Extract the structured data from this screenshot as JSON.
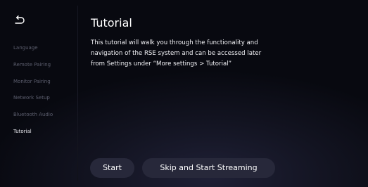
{
  "nav": {
    "back_icon": "back-arrow-icon"
  },
  "sidebar": {
    "items": [
      {
        "label": "Language",
        "active": false
      },
      {
        "label": "Remote Pairing",
        "active": false
      },
      {
        "label": "Monitor Pairing",
        "active": false
      },
      {
        "label": "Network Setup",
        "active": false
      },
      {
        "label": "Bluetooth Audio",
        "active": false
      },
      {
        "label": "Tutorial",
        "active": true
      }
    ]
  },
  "main": {
    "title": "Tutorial",
    "description_lines": [
      "This tutorial will walk you through the functionality and",
      "navigation of the RSE system and can be accessed later",
      "from Settings under “More settings > Tutorial”"
    ]
  },
  "actions": {
    "start_label": "Start",
    "skip_label": "Skip and Start Streaming"
  },
  "colors": {
    "background": "#121320",
    "inactive_text": "#5c5e6e",
    "active_text": "#e8e8ee",
    "button_bg": "#27283a"
  }
}
